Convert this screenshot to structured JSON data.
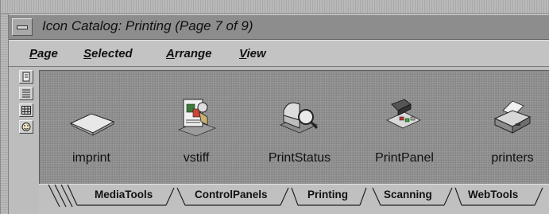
{
  "window": {
    "title": "Icon Catalog: Printing (Page 7 of 9)"
  },
  "menubar": {
    "items": [
      {
        "mnemonic": "P",
        "rest": "age"
      },
      {
        "mnemonic": "S",
        "rest": "elected"
      },
      {
        "mnemonic": "A",
        "rest": "rrange"
      },
      {
        "mnemonic": "V",
        "rest": "iew"
      }
    ]
  },
  "side_buttons": [
    "page-icon",
    "list-view-icon",
    "grid-view-icon",
    "face-icon"
  ],
  "icons": [
    {
      "label": "imprint",
      "icon": "paper-sheet-icon"
    },
    {
      "label": "vstiff",
      "icon": "document-viewer-icon"
    },
    {
      "label": "PrintStatus",
      "icon": "printer-magnifier-icon"
    },
    {
      "label": "PrintPanel",
      "icon": "printer-panel-icon"
    },
    {
      "label": "printers",
      "icon": "printer-icon"
    }
  ],
  "tabs": [
    {
      "label": "MediaTools",
      "selected": false
    },
    {
      "label": "ControlPanels",
      "selected": false
    },
    {
      "label": "Printing",
      "selected": true
    },
    {
      "label": "Scanning",
      "selected": false
    },
    {
      "label": "WebTools",
      "selected": false
    }
  ]
}
